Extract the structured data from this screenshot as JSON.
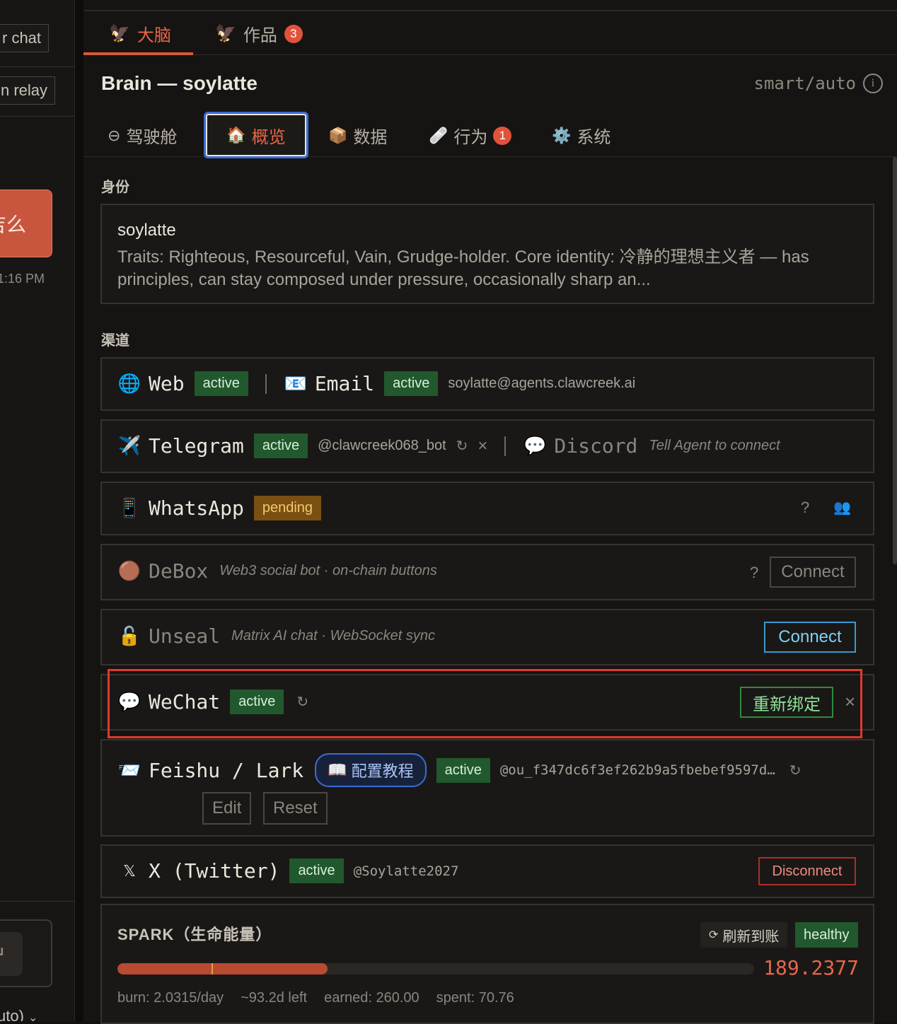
{
  "left_panel": {
    "btn_chat": "r chat",
    "btn_relay": "n relay",
    "bubble_text": "吉么",
    "time": "1:16 PM",
    "enter_icon": "return-icon",
    "mode": "uto)"
  },
  "top_tabs": [
    {
      "label": "大脑",
      "icon": "phoenix-icon",
      "active": true
    },
    {
      "label": "作品",
      "icon": "phoenix-icon",
      "badge": "3",
      "active": false
    }
  ],
  "header": {
    "title": "Brain — soylatte",
    "mode": "smart/auto",
    "info_icon": "info-icon",
    "info_glyph": "i"
  },
  "sub_tabs": [
    {
      "label": "驾驶舱",
      "icon": "cockpit-icon",
      "glyph": "⊖"
    },
    {
      "label": "概览",
      "icon": "house-icon",
      "glyph": "🏠",
      "selected": true
    },
    {
      "label": "数据",
      "icon": "package-icon",
      "glyph": "📦"
    },
    {
      "label": "行为",
      "icon": "bandage-icon",
      "glyph": "🩹",
      "badge": "1"
    },
    {
      "label": "系统",
      "icon": "gear-icon",
      "glyph": "⚙️"
    }
  ],
  "identity": {
    "section": "身份",
    "name": "soylatte",
    "traits": "Traits: Righteous, Resourceful, Vain, Grudge-holder. Core identity: 冷静的理想主义者 — has principles, can stay composed under pressure, occasionally sharp an..."
  },
  "channels_section": "渠道",
  "channels": {
    "web": {
      "name": "Web",
      "icon": "globe-icon",
      "glyph": "🌐",
      "status": "active"
    },
    "email": {
      "name": "Email",
      "icon": "email-icon",
      "glyph": "📧",
      "status": "active",
      "address": "soylatte@agents.clawcreek.ai"
    },
    "telegram": {
      "name": "Telegram",
      "icon": "airplane-icon",
      "glyph": "✈️",
      "status": "active",
      "handle": "@clawcreek068_bot"
    },
    "discord": {
      "name": "Discord",
      "icon": "speech-bubble-icon",
      "glyph": "💬",
      "hint": "Tell Agent to connect"
    },
    "whatsapp": {
      "name": "WhatsApp",
      "icon": "phone-icon",
      "glyph": "📱",
      "status": "pending",
      "help": "?",
      "people_icon": "people-icon"
    },
    "debox": {
      "name": "DeBox",
      "icon": "circle-icon",
      "glyph": "🟤",
      "hint": "Web3 social bot · on-chain buttons",
      "help": "?",
      "button": "Connect"
    },
    "unseal": {
      "name": "Unseal",
      "icon": "lock-icon",
      "glyph": "🔓",
      "hint": "Matrix AI chat · WebSocket sync",
      "button": "Connect"
    },
    "wechat": {
      "name": "WeChat",
      "icon": "speech-bubble-icon",
      "glyph": "💬",
      "status": "active",
      "button": "重新绑定",
      "close": "×"
    },
    "feishu": {
      "name": "Feishu / Lark",
      "icon": "envelope-icon",
      "glyph": "📨",
      "guide": "配置教程",
      "guide_icon": "book-icon",
      "status": "active",
      "handle": "@ou_f347dc6f3ef262b9a5fbebef9597d…",
      "edit": "Edit",
      "reset": "Reset"
    },
    "twitter": {
      "name": "X (Twitter)",
      "icon": "x-logo-icon",
      "glyph": "𝕏",
      "status": "active",
      "handle": "@Soylatte2027",
      "button": "Disconnect"
    }
  },
  "refresh_glyph": "↻",
  "close_glyph": "×",
  "spark": {
    "title": "SPARK（生命能量）",
    "refresh_label": "刷新到账",
    "refresh_icon": "refresh-icon",
    "status": "healthy",
    "value": "189.2377",
    "fill_fraction": 0.33,
    "marker_fraction": 0.148,
    "burn": "burn: 2.0315/day",
    "left": "~93.2d left",
    "earned": "earned: 260.00",
    "spent": "spent: 70.76"
  },
  "colors": {
    "accent": "#e8664a",
    "active": "#21582d",
    "pending": "#7a4f12",
    "highlight": "#e0392e",
    "link": "#3b6cd6"
  }
}
